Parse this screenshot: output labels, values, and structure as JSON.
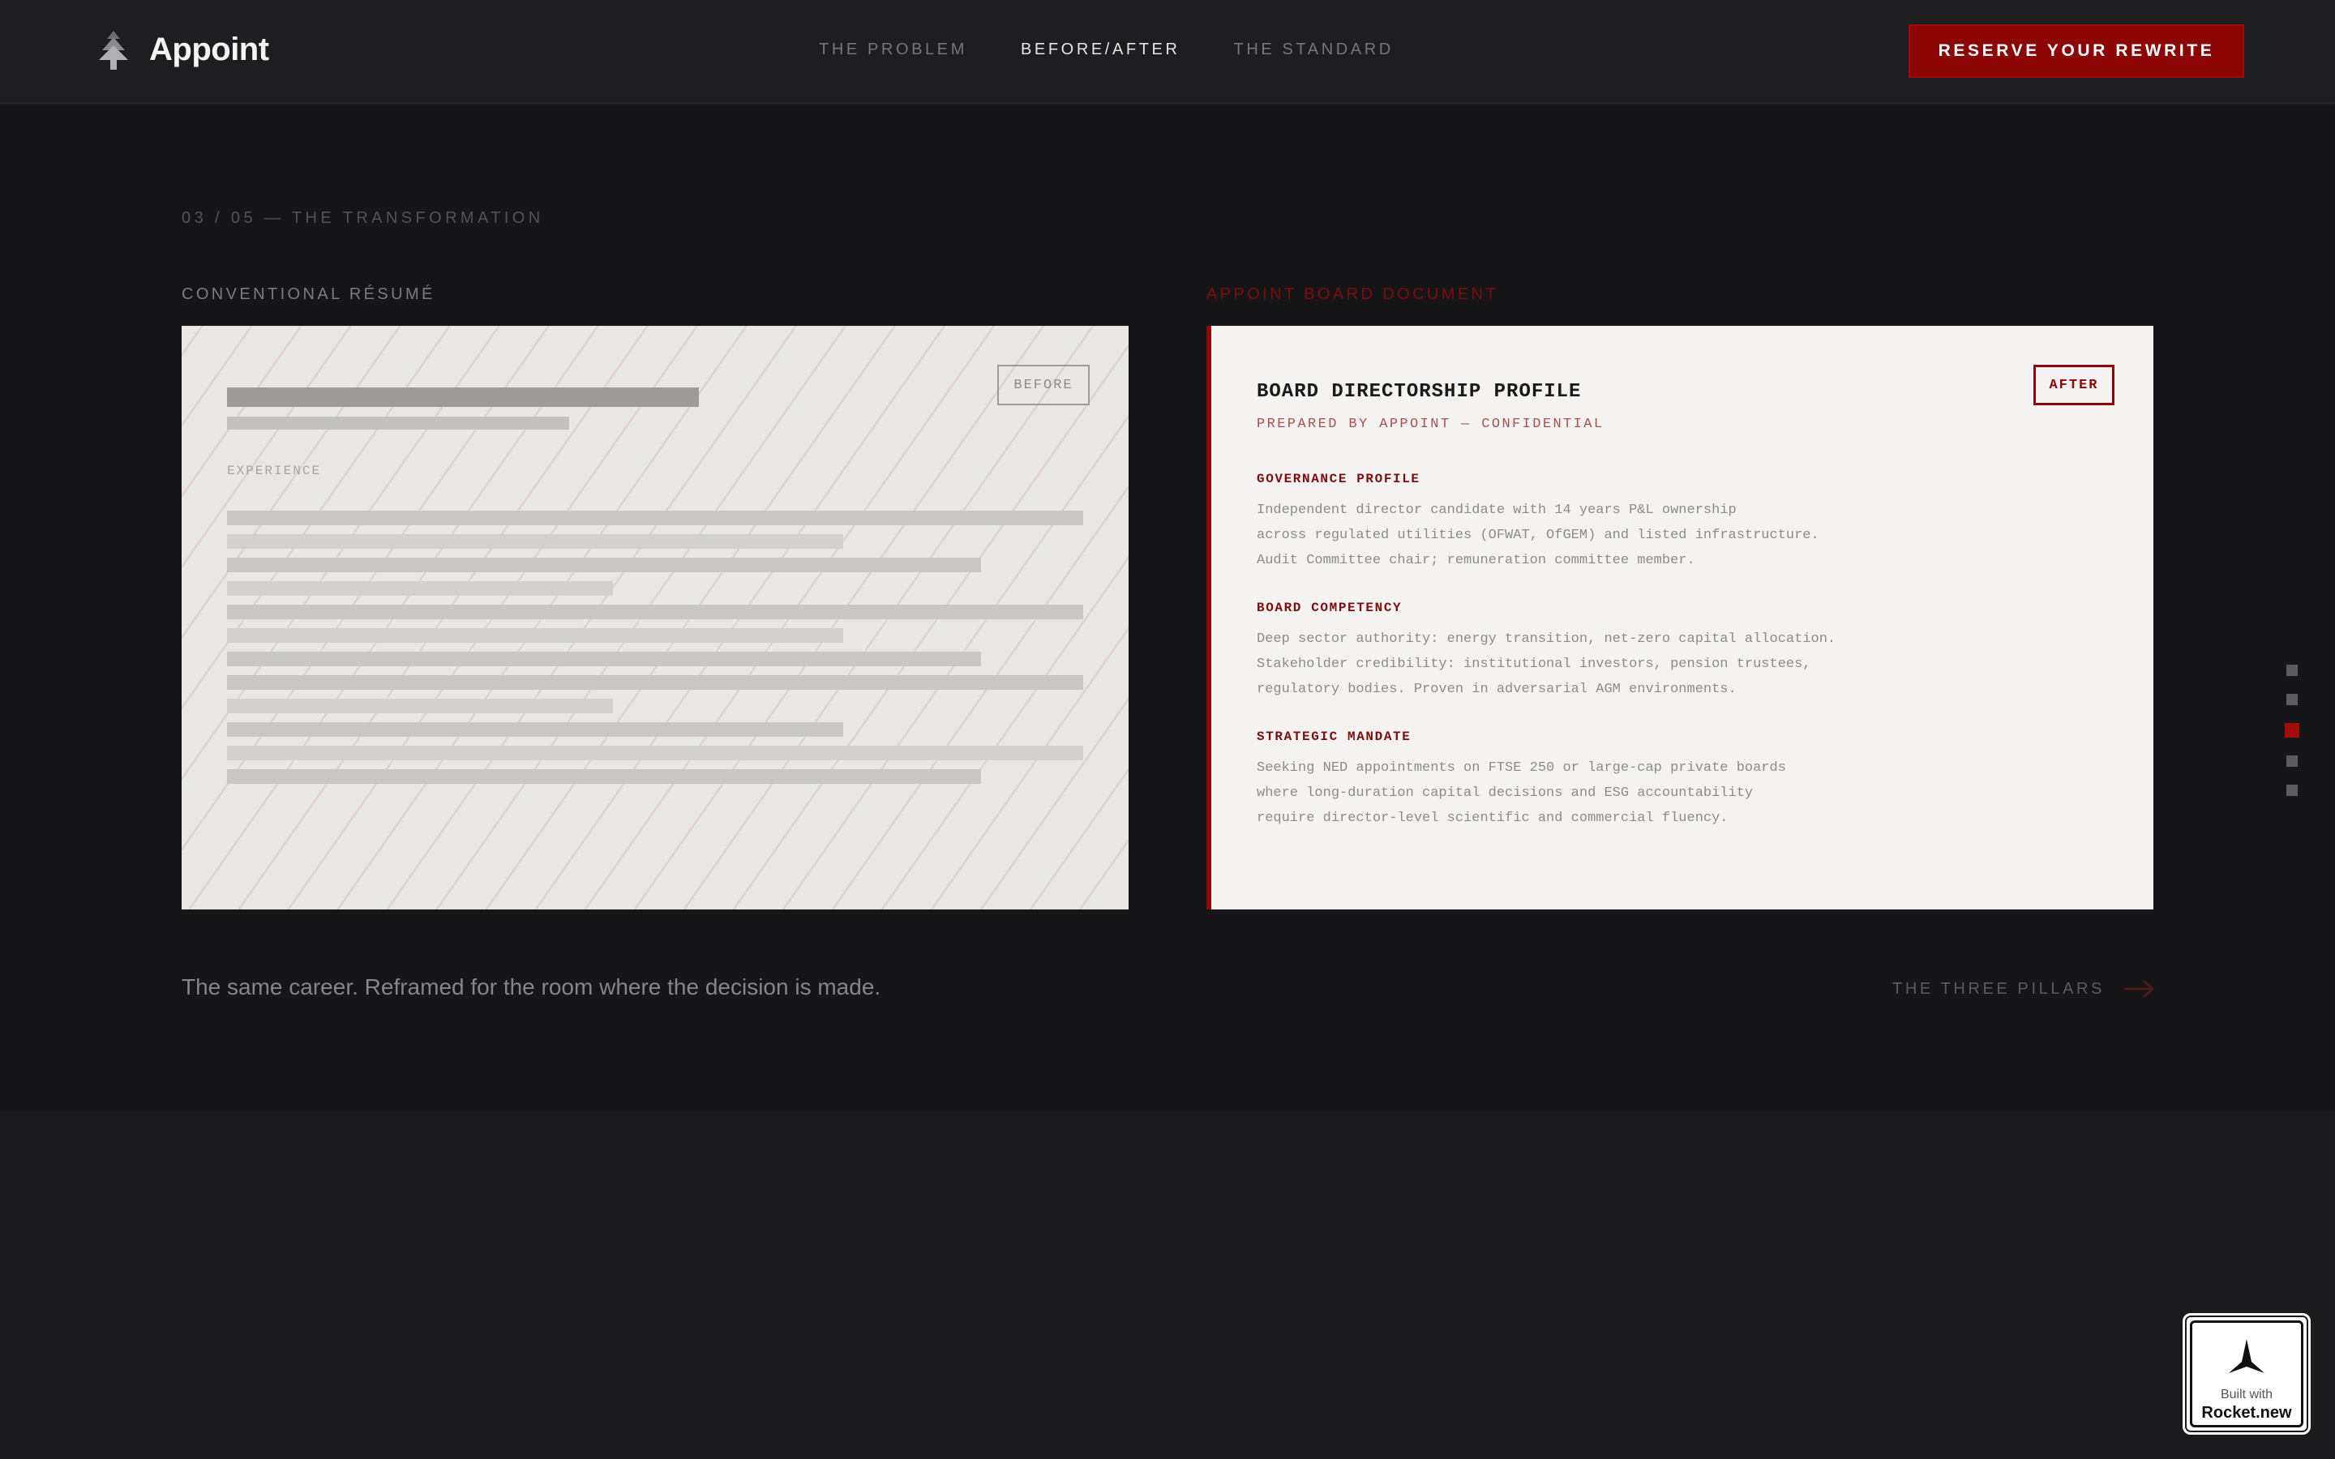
{
  "header": {
    "brand": "Appoint",
    "nav": [
      {
        "label": "THE PROBLEM",
        "active": false
      },
      {
        "label": "BEFORE/AFTER",
        "active": true
      },
      {
        "label": "THE STANDARD",
        "active": false
      }
    ],
    "cta_label": "RESERVE YOUR REWRITE"
  },
  "section": {
    "eyebrow": "03 / 05 — THE TRANSFORMATION",
    "before": {
      "label": "CONVENTIONAL RÉSUMÉ",
      "badge": "BEFORE",
      "experience_label": "EXPERIENCE"
    },
    "after": {
      "label": "APPOINT BOARD DOCUMENT",
      "badge": "AFTER",
      "title": "BOARD DIRECTORSHIP PROFILE",
      "subtitle": "PREPARED BY APPOINT — CONFIDENTIAL",
      "sections": [
        {
          "heading": "GOVERNANCE PROFILE",
          "body": "Independent director candidate with 14 years P&L ownership\nacross regulated utilities (OFWAT, OfGEM) and listed infrastructure.\nAudit Committee chair; remuneration committee member."
        },
        {
          "heading": "BOARD COMPETENCY",
          "body": "Deep sector authority: energy transition, net-zero capital allocation.\nStakeholder credibility: institutional investors, pension trustees,\nregulatory bodies. Proven in adversarial AGM environments."
        },
        {
          "heading": "STRATEGIC MANDATE",
          "body": "Seeking NED appointments on FTSE 250 or large-cap private boards\nwhere long-duration capital decisions and ESG accountability\nrequire director-level scientific and commercial fluency."
        }
      ]
    },
    "tagline": "The same career. Reframed for the room where the decision is made.",
    "next_label": "THE THREE PILLARS"
  },
  "pagination": {
    "total": 5,
    "current": 3
  },
  "built_with": {
    "small": "Built with",
    "big": "Rocket.new"
  },
  "colors": {
    "accent": "#8c0606",
    "background": "#161618",
    "header": "#1e1e20"
  }
}
